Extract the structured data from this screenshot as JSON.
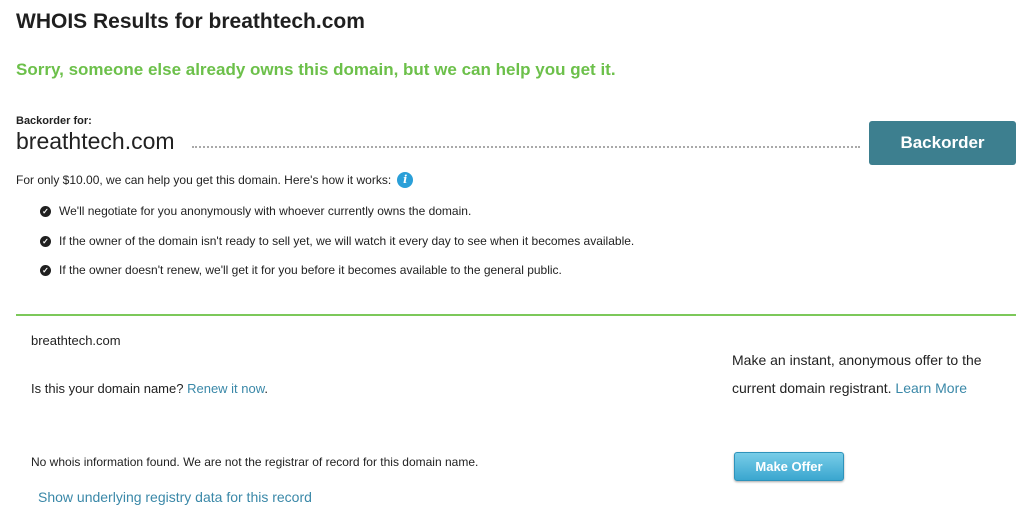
{
  "page": {
    "title": "WHOIS Results for breathtech.com",
    "headline": "Sorry, someone else already owns this domain, but we can help you get it."
  },
  "backorder": {
    "label": "Backorder for:",
    "domain": "breathtech.com",
    "button_label": "Backorder",
    "price_text": "For only $10.00, we can help you get this domain. Here's how it works:",
    "info_icon": "info-icon",
    "bullets": [
      "We'll negotiate for you anonymously with whoever currently owns the domain.",
      "If the owner of the domain isn't ready to sell yet, we will watch it every day to see when it becomes available.",
      "If the owner doesn't renew, we'll get it for you before it becomes available to the general public."
    ]
  },
  "whois": {
    "domain": "breathtech.com",
    "renew_prompt": "Is this your domain name?",
    "renew_link": "Renew it now",
    "renew_suffix": ".",
    "no_info": "No whois information found. We are not the registrar of record for this domain name.",
    "registry_link": "Show underlying registry data for this record"
  },
  "offer": {
    "text": "Make an instant, anonymous offer to the current domain registrant.",
    "learn_more": "Learn More",
    "button_label": "Make Offer"
  },
  "colors": {
    "headline_green": "#6cc04a",
    "backorder_button": "#3d7f8f",
    "link_blue": "#3a88a8",
    "divider_green": "#7cc85a",
    "offer_button": "#3aa6cf"
  }
}
